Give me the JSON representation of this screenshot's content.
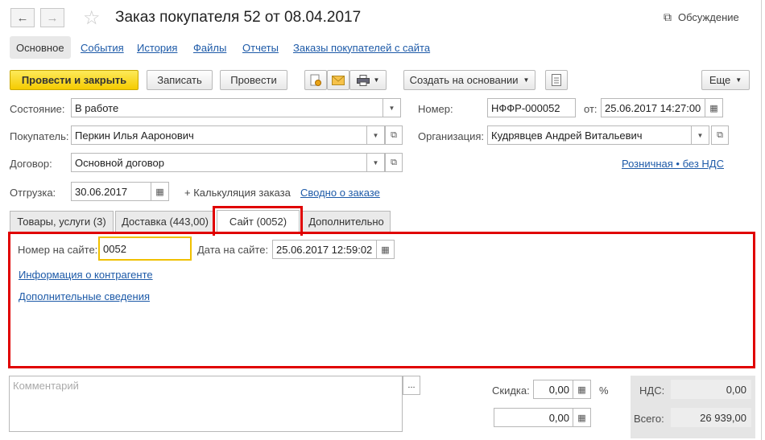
{
  "header": {
    "back_icon": "←",
    "forward_icon": "→",
    "star_icon": "☆",
    "title": "Заказ покупателя 52 от 08.04.2017",
    "discussion_label": "Обсуждение",
    "discussion_icon": "⧉"
  },
  "nav_tabs": [
    {
      "label": "Основное"
    },
    {
      "label": "События"
    },
    {
      "label": "История"
    },
    {
      "label": "Файлы"
    },
    {
      "label": "Отчеты"
    },
    {
      "label": "Заказы покупателей с сайта"
    }
  ],
  "toolbar": {
    "post_close": "Провести и закрыть",
    "save": "Записать",
    "post": "Провести",
    "create_based": "Создать на основании",
    "more": "Еще"
  },
  "form": {
    "state_label": "Состояние:",
    "state_value": "В работе",
    "buyer_label": "Покупатель:",
    "buyer_value": "Перкин Илья Ааронович",
    "contract_label": "Договор:",
    "contract_value": "Основной договор",
    "shipment_label": "Отгрузка:",
    "shipment_value": "30.06.2017",
    "calc_label": "+ Калькуляция заказа",
    "summary_link": "Сводно о заказе",
    "number_label": "Номер:",
    "number_value": "НФФР-000052",
    "from_label": "от:",
    "from_value": "25.06.2017 14:27:00",
    "org_label": "Организация:",
    "org_value": "Кудрявцев Андрей Витальевич",
    "price_link": "Розничная • без НДС"
  },
  "form_tabs": [
    {
      "label": "Товары, услуги (3)"
    },
    {
      "label": "Доставка (443,00)"
    },
    {
      "label": "Сайт (0052)"
    },
    {
      "label": "Дополнительно"
    }
  ],
  "site_tab": {
    "site_number_label": "Номер на сайте:",
    "site_number_value": "0052",
    "site_date_label": "Дата на сайте:",
    "site_date_value": "25.06.2017 12:59:02",
    "contractor_info_link": "Информация о контрагенте",
    "extra_info_link": "Дополнительные сведения"
  },
  "footer": {
    "comment_placeholder": "Комментарий",
    "ellipsis": "...",
    "discount_label": "Скидка:",
    "discount_value": "0,00",
    "percent": "%",
    "second_value": "0,00",
    "vat_label": "НДС:",
    "vat_value": "0,00",
    "total_label": "Всего:",
    "total_value": "26 939,00"
  },
  "colors": {
    "primary_button": "#f5cb00",
    "highlight_red": "#e00000",
    "link": "#1d5aa8",
    "focus_border": "#f0c000"
  }
}
